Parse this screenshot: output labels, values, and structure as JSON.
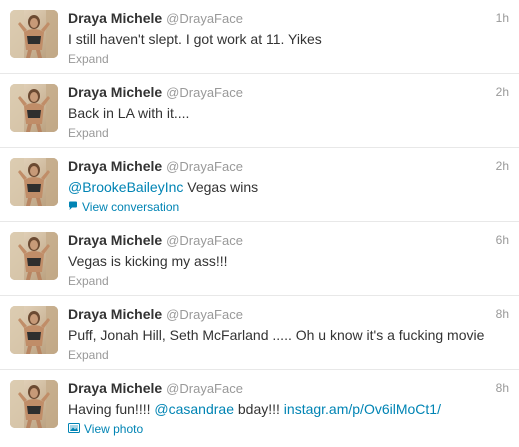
{
  "tweets": [
    {
      "name": "Draya Michele",
      "handle": "@DrayaFace",
      "time": "1h",
      "text_parts": [
        {
          "t": "I still haven't slept. I got work at 11. Yikes",
          "link": false
        }
      ],
      "action": "Expand",
      "action_type": "expand"
    },
    {
      "name": "Draya Michele",
      "handle": "@DrayaFace",
      "time": "2h",
      "text_parts": [
        {
          "t": "Back in LA with it....",
          "link": false
        }
      ],
      "action": "Expand",
      "action_type": "expand"
    },
    {
      "name": "Draya Michele",
      "handle": "@DrayaFace",
      "time": "2h",
      "text_parts": [
        {
          "t": "@BrookeBaileyInc",
          "link": true
        },
        {
          "t": " Vegas wins",
          "link": false
        }
      ],
      "action": "View conversation",
      "action_type": "conversation",
      "action_icon": "speech-bubble-icon"
    },
    {
      "name": "Draya Michele",
      "handle": "@DrayaFace",
      "time": "6h",
      "text_parts": [
        {
          "t": "Vegas is kicking my ass!!!",
          "link": false
        }
      ],
      "action": "Expand",
      "action_type": "expand"
    },
    {
      "name": "Draya Michele",
      "handle": "@DrayaFace",
      "time": "8h",
      "text_parts": [
        {
          "t": "Puff, Jonah Hill, Seth McFarland ..... Oh u know it's a fucking movie",
          "link": false
        }
      ],
      "action": "Expand",
      "action_type": "expand"
    },
    {
      "name": "Draya Michele",
      "handle": "@DrayaFace",
      "time": "8h",
      "text_parts": [
        {
          "t": "Having fun!!!! ",
          "link": false
        },
        {
          "t": "@casandrae",
          "link": true
        },
        {
          "t": " bday!!! ",
          "link": false
        },
        {
          "t": "instagr.am/p/Ov6ilMoCt1/",
          "link": true
        }
      ],
      "action": "View photo",
      "action_type": "photo",
      "action_icon": "photo-icon"
    }
  ],
  "colors": {
    "link": "#0084b4",
    "meta": "#999999",
    "text": "#333333",
    "divider": "#e8e8e8"
  }
}
